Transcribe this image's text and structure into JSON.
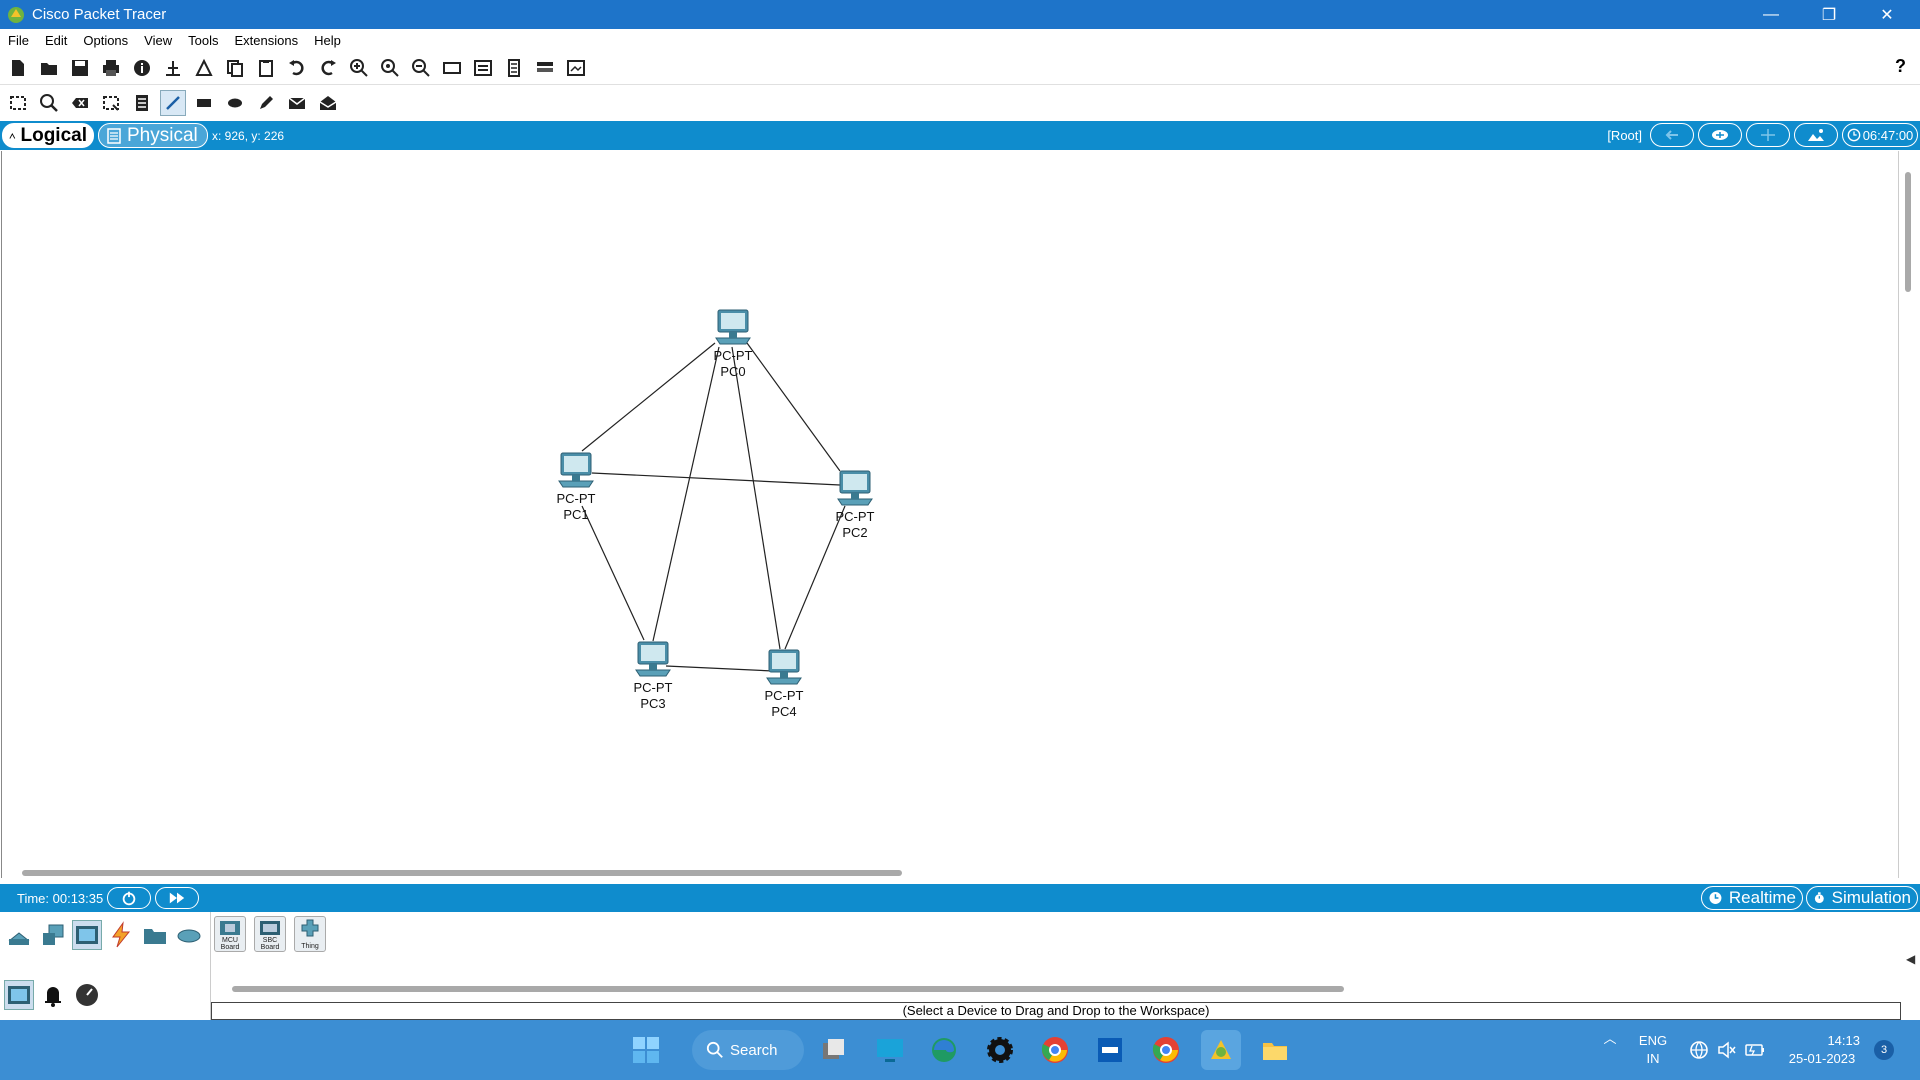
{
  "window": {
    "title": "Cisco Packet Tracer",
    "minimize": "—",
    "restore": "❐",
    "close": "✕"
  },
  "menu": [
    "File",
    "Edit",
    "Options",
    "View",
    "Tools",
    "Extensions",
    "Help"
  ],
  "toolbar": {
    "help": "?"
  },
  "viewbar": {
    "logical_label": "Logical",
    "physical_label": "Physical",
    "coords": "x: 926, y: 226",
    "root_label": "[Root]",
    "clock": "06:47:00"
  },
  "devices": [
    {
      "type": "PC-PT",
      "name": "PC0"
    },
    {
      "type": "PC-PT",
      "name": "PC1"
    },
    {
      "type": "PC-PT",
      "name": "PC2"
    },
    {
      "type": "PC-PT",
      "name": "PC3"
    },
    {
      "type": "PC-PT",
      "name": "PC4"
    }
  ],
  "timebar": {
    "time": "Time: 00:13:35",
    "realtime_label": "Realtime",
    "simulation_label": "Simulation"
  },
  "device_panel": {
    "tiles": [
      {
        "line1": "MCU",
        "line2": "Board"
      },
      {
        "line1": "SBC",
        "line2": "Board"
      },
      {
        "line1": "",
        "line2": "Thing"
      }
    ],
    "status": "(Select a Device to Drag and Drop to the Workspace)"
  },
  "taskbar": {
    "search_label": "Search",
    "lang_line1": "ENG",
    "lang_line2": "IN",
    "time": "14:13",
    "date": "25-01-2023",
    "notifications": "3"
  },
  "colors": {
    "titlebar": "#1e74c9",
    "accent": "#0f8ccd",
    "taskbar": "#3c8ed3"
  }
}
